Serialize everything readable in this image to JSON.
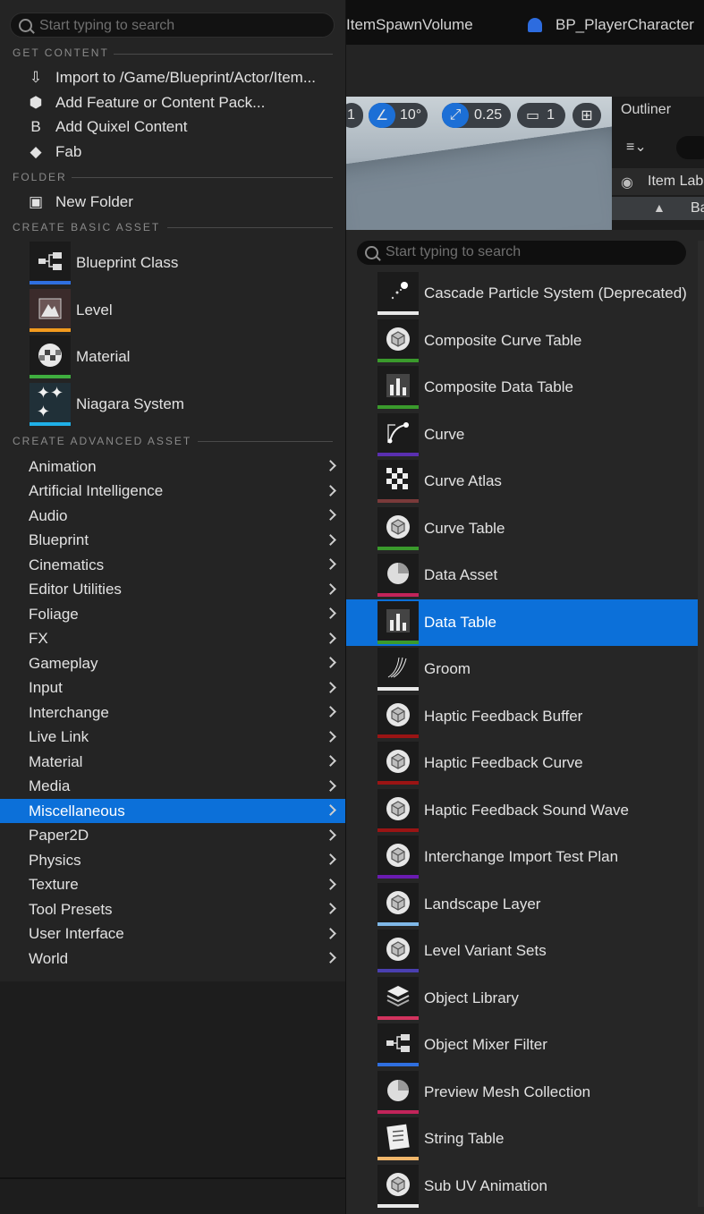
{
  "background": {
    "tabs": [
      "ItemSpawnVolume",
      "BP_PlayerCharacter"
    ],
    "viewport_controls": {
      "first": "1",
      "angle": "10°",
      "scale": "0.25",
      "camera": "1"
    },
    "outliner_title": "Outliner",
    "outliner_col": "Item Lab",
    "outliner_row": "Ba"
  },
  "menu": {
    "search_placeholder": "Start typing to search",
    "sections": {
      "get_content": "GET CONTENT",
      "folder": "FOLDER",
      "basic": "CREATE BASIC ASSET",
      "advanced": "CREATE ADVANCED ASSET"
    },
    "get_content_items": [
      "Import to /Game/Blueprint/Actor/Item...",
      "Add Feature or Content Pack...",
      "Add Quixel Content",
      "Fab"
    ],
    "folder_items": [
      "New Folder"
    ],
    "basic_items": [
      {
        "label": "Blueprint Class",
        "color": "#2f6fe0"
      },
      {
        "label": "Level",
        "color": "#f39a1e"
      },
      {
        "label": "Material",
        "color": "#3fae3f"
      },
      {
        "label": "Niagara System",
        "color": "#1fb0e8"
      }
    ],
    "advanced_items": [
      "Animation",
      "Artificial Intelligence",
      "Audio",
      "Blueprint",
      "Cinematics",
      "Editor Utilities",
      "Foliage",
      "FX",
      "Gameplay",
      "Input",
      "Interchange",
      "Live Link",
      "Material",
      "Media",
      "Miscellaneous",
      "Paper2D",
      "Physics",
      "Texture",
      "Tool Presets",
      "User Interface",
      "World"
    ],
    "selected_advanced": "Miscellaneous"
  },
  "submenu": {
    "search_placeholder": "Start typing to search",
    "selected": "Data Table",
    "items": [
      {
        "label": "Cascade Particle System (Deprecated)",
        "color": "#e8e8e8",
        "icon": "sparkle-icon"
      },
      {
        "label": "Composite Curve Table",
        "color": "#3a9a2c",
        "icon": "cube-icon"
      },
      {
        "label": "Composite Data Table",
        "color": "#3a9a2c",
        "icon": "bar-chart-icon"
      },
      {
        "label": "Curve",
        "color": "#5a2fb0",
        "icon": "curve-icon"
      },
      {
        "label": "Curve Atlas",
        "color": "#7a3a3a",
        "icon": "checker-icon"
      },
      {
        "label": "Curve Table",
        "color": "#3a9a2c",
        "icon": "cube-icon"
      },
      {
        "label": "Data Asset",
        "color": "#c2245a",
        "icon": "pie-icon"
      },
      {
        "label": "Data Table",
        "color": "#3a9a2c",
        "icon": "bar-chart-icon"
      },
      {
        "label": "Groom",
        "color": "#e8e8e8",
        "icon": "groom-icon"
      },
      {
        "label": "Haptic Feedback Buffer",
        "color": "#9a1414",
        "icon": "cube-icon"
      },
      {
        "label": "Haptic Feedback Curve",
        "color": "#9a1414",
        "icon": "cube-icon"
      },
      {
        "label": "Haptic Feedback Sound Wave",
        "color": "#9a1414",
        "icon": "cube-icon"
      },
      {
        "label": "Interchange Import Test Plan",
        "color": "#6a1bb0",
        "icon": "cube-icon"
      },
      {
        "label": "Landscape Layer",
        "color": "#7fb8e8",
        "icon": "cube-icon"
      },
      {
        "label": "Level Variant Sets",
        "color": "#4a3fb0",
        "icon": "cube-icon"
      },
      {
        "label": "Object Library",
        "color": "#d2335e",
        "icon": "stack-icon"
      },
      {
        "label": "Object Mixer Filter",
        "color": "#2f6fe0",
        "icon": "blueprint-icon"
      },
      {
        "label": "Preview Mesh Collection",
        "color": "#c2245a",
        "icon": "pie-icon"
      },
      {
        "label": "String Table",
        "color": "#f0b66a",
        "icon": "list-icon"
      },
      {
        "label": "Sub UV Animation",
        "color": "#e8e8e8",
        "icon": "cube-icon"
      }
    ]
  }
}
